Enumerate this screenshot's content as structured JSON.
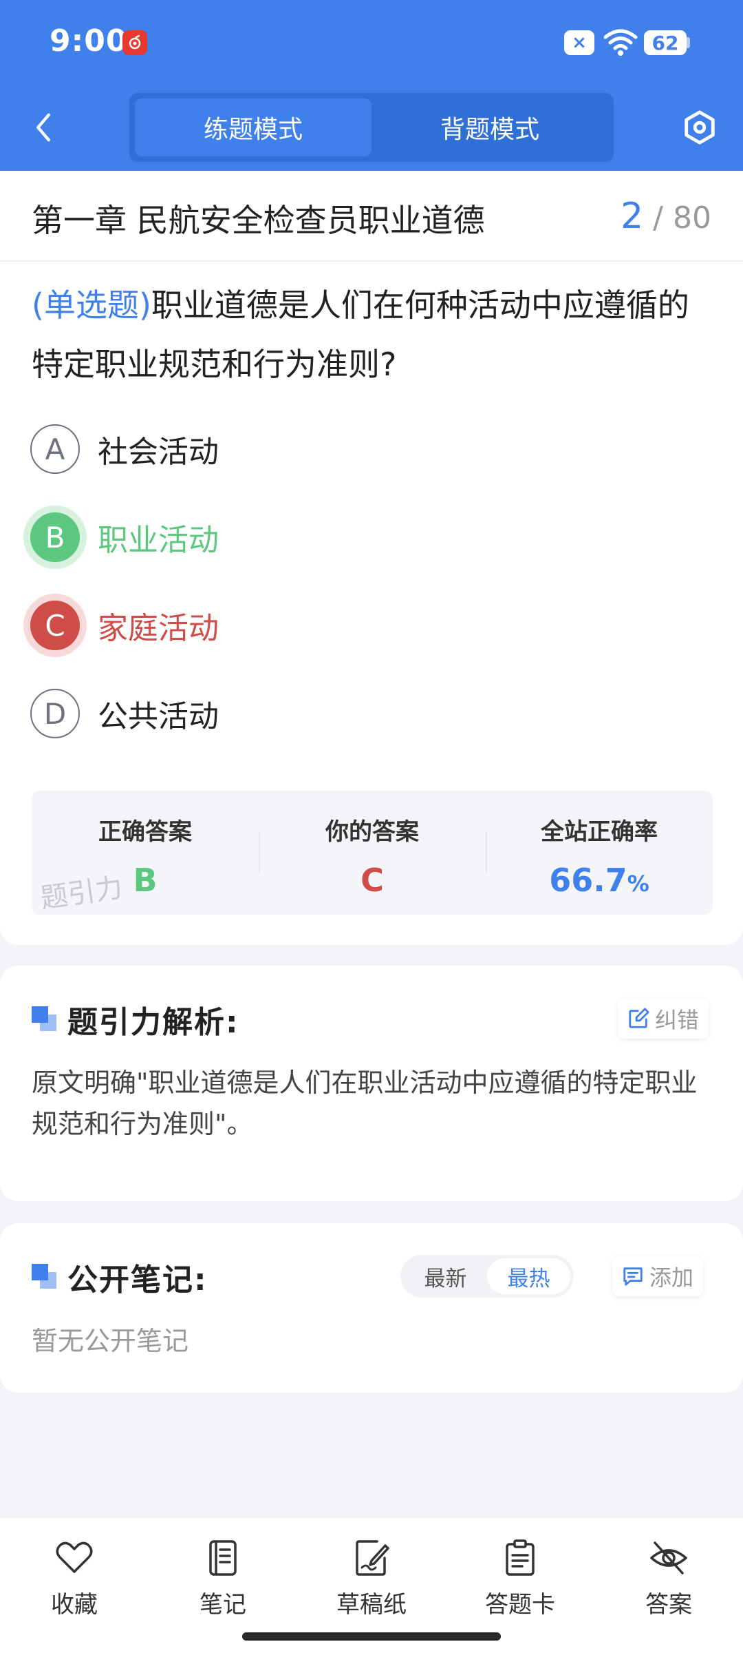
{
  "status_bar": {
    "time": "9:00",
    "battery": "62",
    "sim_icon_label": "×"
  },
  "header": {
    "back_icon": "chevron-left-icon",
    "tabs": [
      {
        "label": "练题模式",
        "active": true
      },
      {
        "label": "背题模式",
        "active": false
      }
    ],
    "settings_icon": "hexagon-settings-icon",
    "color": "#3f80ea"
  },
  "chapter": {
    "title": "第一章 民航安全检查员职业道德",
    "current": "2",
    "separator": "/",
    "total": "80"
  },
  "question": {
    "type_label": "(单选题)",
    "text": "职业道德是人们在何种活动中应遵循的特定职业规范和行为准则?",
    "options": [
      {
        "letter": "A",
        "text": "社会活动",
        "state": "normal"
      },
      {
        "letter": "B",
        "text": "职业活动",
        "state": "correct"
      },
      {
        "letter": "C",
        "text": "家庭活动",
        "state": "wrong"
      },
      {
        "letter": "D",
        "text": "公共活动",
        "state": "normal"
      }
    ]
  },
  "stats": {
    "correct_label": "正确答案",
    "correct_value": "B",
    "yours_label": "你的答案",
    "yours_value": "C",
    "rate_label": "全站正确率",
    "rate_value": "66.7",
    "rate_unit": "%",
    "watermark": "题引力"
  },
  "analysis": {
    "title": "题引力解析:",
    "report_label": "纠错",
    "text": "原文明确\"职业道德是人们在职业活动中应遵循的特定职业规范和行为准则\"。"
  },
  "notes": {
    "title": "公开笔记:",
    "sort_options": [
      {
        "label": "最新",
        "active": false
      },
      {
        "label": "最热",
        "active": true
      }
    ],
    "add_label": "添加",
    "empty_text": "暂无公开笔记"
  },
  "bottom_bar": {
    "items": [
      {
        "label": "收藏",
        "icon": "heart-icon"
      },
      {
        "label": "笔记",
        "icon": "notebook-icon"
      },
      {
        "label": "草稿纸",
        "icon": "draft-paper-icon"
      },
      {
        "label": "答题卡",
        "icon": "answer-sheet-icon"
      },
      {
        "label": "答案",
        "icon": "eye-off-icon"
      }
    ]
  },
  "colors": {
    "primary": "#3f80ea",
    "correct": "#5cc77f",
    "wrong": "#cf4c48"
  }
}
